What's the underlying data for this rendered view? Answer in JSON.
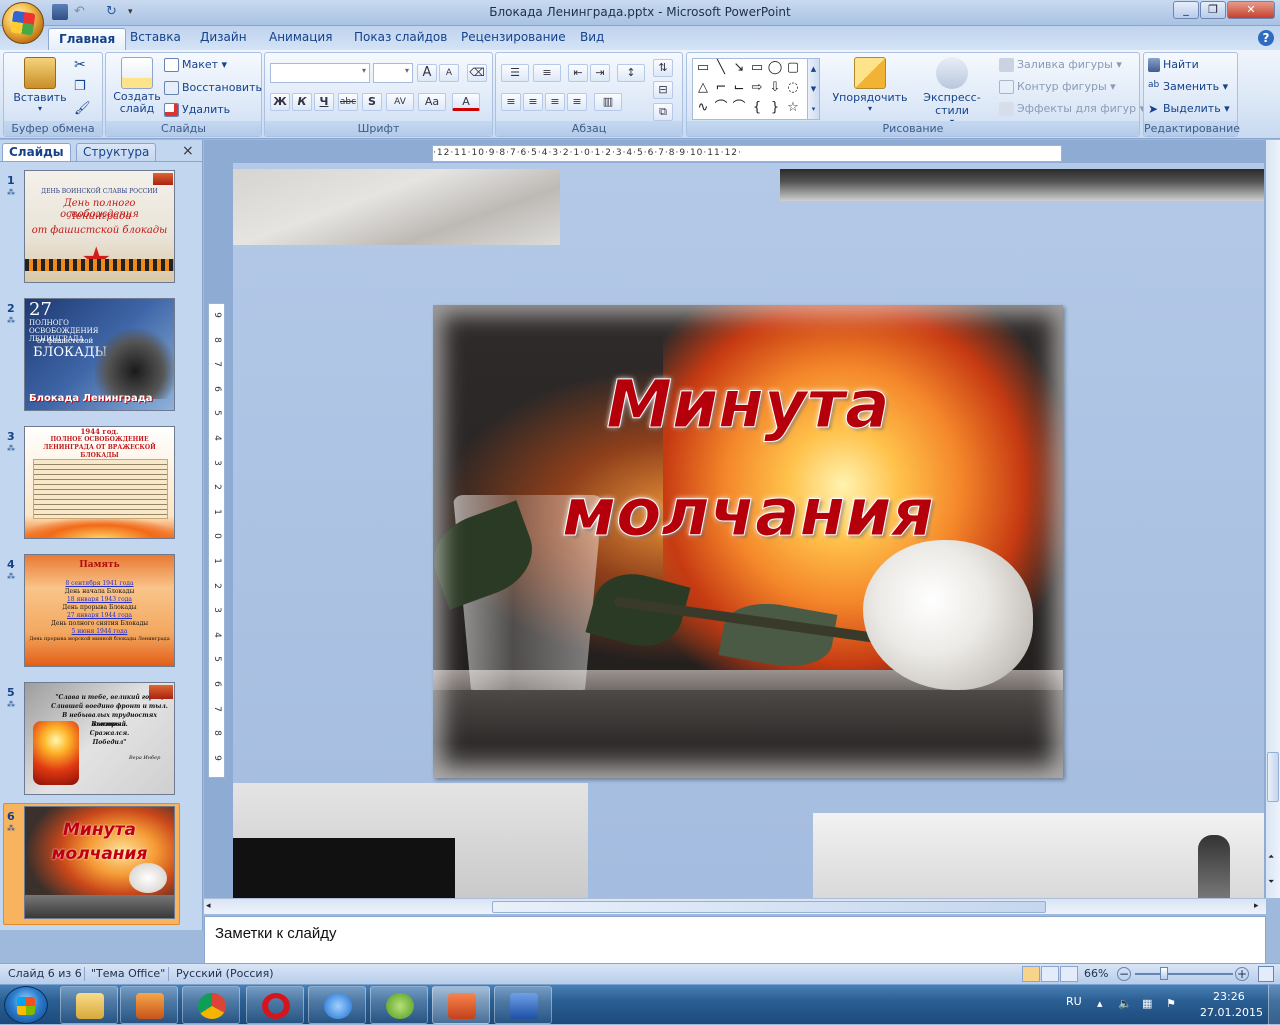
{
  "window": {
    "title": "Блокада Ленинграда.pptx - Microsoft PowerPoint"
  },
  "tabs": [
    "Главная",
    "Вставка",
    "Дизайн",
    "Анимация",
    "Показ слайдов",
    "Рецензирование",
    "Вид"
  ],
  "ribbon": {
    "clipboard": {
      "label": "Буфер обмена",
      "paste": "Вставить"
    },
    "slides": {
      "label": "Слайды",
      "new_slide": "Создать слайд",
      "layout": "Макет",
      "reset": "Восстановить",
      "delete": "Удалить"
    },
    "font": {
      "label": "Шрифт",
      "bold": "Ж",
      "italic": "К",
      "underline": "Ч",
      "strike": "abc",
      "shadow": "S",
      "spacing": "AV",
      "case": "Aa",
      "grow": "A",
      "shrink": "A",
      "color": "A"
    },
    "paragraph": {
      "label": "Абзац"
    },
    "drawing": {
      "label": "Рисование",
      "arrange": "Упорядочить",
      "quick_styles": "Экспресс-стили",
      "fill": "Заливка фигуры",
      "outline": "Контур фигуры",
      "effects": "Эффекты для фигур"
    },
    "editing": {
      "label": "Редактирование",
      "find": "Найти",
      "replace": "Заменить",
      "select": "Выделить"
    }
  },
  "left_pane": {
    "tab_slides": "Слайды",
    "tab_outline": "Структура",
    "close": "×"
  },
  "thumbnails": [
    {
      "num": "1",
      "line1": "ДЕНЬ ВОИНСКОЙ СЛАВЫ РОССИИ",
      "line2": "День полного освобождения",
      "line3": "Ленинграда",
      "line4": "от фашистской блокады"
    },
    {
      "num": "2",
      "line1": "27",
      "line2": "ПОЛНОГО ОСВОБОЖДЕНИЯ ЛЕНИНГРАДА",
      "line3": "от фашистской",
      "line4": "БЛОКАДЫ",
      "line5": "Блокада Ленинграда"
    },
    {
      "num": "3",
      "line1": "1944 год.",
      "line2": "ПОЛНОЕ ОСВОБОЖДЕНИЕ ЛЕНИНГРАДА ОТ ВРАЖЕСКОЙ БЛОКАДЫ"
    },
    {
      "num": "4",
      "line1": "Память",
      "line2": "8 сентября 1941 года",
      "line3": "День начала Блокады",
      "line4": "18 января 1943 года",
      "line5": "День прорыва Блокады",
      "line6": "27 января 1944 года",
      "line7": "День полного снятия Блокады",
      "line8": "5 июня 1944 года",
      "line9": "День прорыва морской минной блокады Ленинграда"
    },
    {
      "num": "5",
      "line1": "\"Слава и тебе, великий город,",
      "line2": "Слившей воедино фронт и тыл.",
      "line3": "В небывалых трудностях который",
      "line4": "Выстоял.",
      "line5": "Сражался.",
      "line6": "Победил\"",
      "line7": "Вера Инбер"
    },
    {
      "num": "6",
      "line1": "Минута",
      "line2": "молчания"
    }
  ],
  "slide": {
    "title_line1": "Минута",
    "title_line2": "молчания"
  },
  "ruler": {
    "h": "·12·11·10·9·8·7·6·5·4·3·2·1·0·1·2·3·4·5·6·7·8·9·10·11·12·",
    "v": [
      "9",
      "8",
      "7",
      "6",
      "5",
      "4",
      "3",
      "2",
      "1",
      "0",
      "1",
      "2",
      "3",
      "4",
      "5",
      "6",
      "7",
      "8",
      "9"
    ]
  },
  "notes": {
    "placeholder": "Заметки к слайду"
  },
  "status": {
    "slide": "Слайд 6 из 6",
    "theme": "\"Тема Office\"",
    "lang": "Русский (Россия)",
    "zoom": "66%"
  },
  "taskbar": {
    "lang": "RU",
    "time": "23:26",
    "date": "27.01.2015"
  },
  "colors": {
    "accent": "#15428b",
    "title_red": "#b5000b",
    "selection": "#f8b35f"
  }
}
